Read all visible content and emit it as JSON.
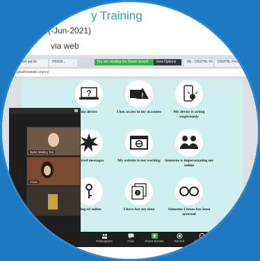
{
  "slide": {
    "title": "y Training",
    "date": "(-Jun-2021)",
    "via": "via web"
  },
  "browser": {
    "tabs": [
      "Digital first aid kit",
      "INVEN...",
      "My - DIGITAL Fir...",
      "DIGITAL First Aid..."
    ],
    "share_banner": "You are viewing the Share screen",
    "view_options": "View Options",
    "url": "digitalfirstaidkit.org/en/"
  },
  "cards": [
    {
      "label": "my device",
      "icon": "question-laptop-icon"
    },
    {
      "label": "I lost access to my accounts",
      "icon": "warning-id-icon"
    },
    {
      "label": "My device is acting suspiciously",
      "icon": "phone-bug-icon"
    },
    {
      "label": "received messages",
      "icon": "explosion-icon"
    },
    {
      "label": "My website is not working",
      "icon": "browser-error-icon"
    },
    {
      "label": "Someone is impersonating me online",
      "icon": "people-icon"
    },
    {
      "label": "being ed online",
      "icon": "key-icon"
    },
    {
      "label": "I have lost my data",
      "icon": "documents-icon"
    },
    {
      "label": "Someone I know has been arrested",
      "icon": "handcuffs-icon"
    }
  ],
  "zoom": {
    "participants": [
      {
        "name": "Nyan Mealcy Tan"
      },
      {
        "name": "Clara"
      },
      {
        "name": ""
      }
    ]
  },
  "controls": [
    {
      "label": "Participants",
      "icon": "participants-icon"
    },
    {
      "label": "Chat",
      "icon": "chat-icon"
    },
    {
      "label": "Share Screen",
      "icon": "share-screen-icon",
      "color": "#2fb34a"
    },
    {
      "label": "Record",
      "icon": "record-icon"
    },
    {
      "label": "Reactions",
      "icon": "reactions-icon"
    }
  ]
}
